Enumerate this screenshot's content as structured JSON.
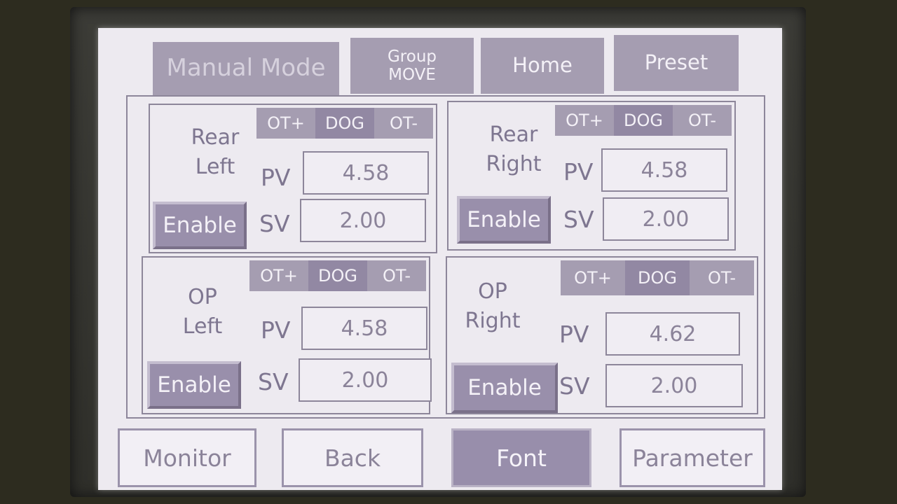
{
  "header": {
    "title": "Manual Mode",
    "group_move": "Group\nMOVE",
    "home": "Home",
    "preset": "Preset"
  },
  "panels": [
    {
      "name": "Rear\nLeft",
      "ot_plus": "OT+",
      "dog": "DOG",
      "ot_minus": "OT-",
      "pv_label": "PV",
      "pv": "4.58",
      "sv_label": "SV",
      "sv": "2.00",
      "enable": "Enable"
    },
    {
      "name": "Rear\nRight",
      "ot_plus": "OT+",
      "dog": "DOG",
      "ot_minus": "OT-",
      "pv_label": "PV",
      "pv": "4.58",
      "sv_label": "SV",
      "sv": "2.00",
      "enable": "Enable"
    },
    {
      "name": "OP\nLeft",
      "ot_plus": "OT+",
      "dog": "DOG",
      "ot_minus": "OT-",
      "pv_label": "PV",
      "pv": "4.58",
      "sv_label": "SV",
      "sv": "2.00",
      "enable": "Enable"
    },
    {
      "name": "OP\nRight",
      "ot_plus": "OT+",
      "dog": "DOG",
      "ot_minus": "OT-",
      "pv_label": "PV",
      "pv": "4.62",
      "sv_label": "SV",
      "sv": "2.00",
      "enable": "Enable"
    }
  ],
  "footer": {
    "monitor": "Monitor",
    "back": "Back",
    "font": "Font",
    "parameter": "Parameter"
  },
  "colors": {
    "button_fill": "#a59db1",
    "active_fill": "#988eab",
    "screen_bg": "#edeaf0",
    "text": "#7e7690"
  }
}
